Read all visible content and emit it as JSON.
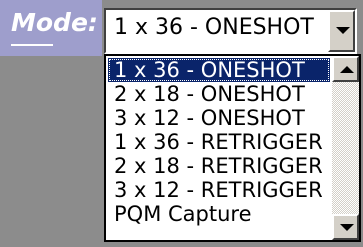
{
  "label": {
    "text": "Mode:"
  },
  "combo": {
    "value": "1 x 36 - ONESHOT"
  },
  "list": {
    "items": [
      {
        "label": "1 x 36 - ONESHOT",
        "selected": true
      },
      {
        "label": "2 x 18 - ONESHOT",
        "selected": false
      },
      {
        "label": "3 x 12 - ONESHOT",
        "selected": false
      },
      {
        "label": "1 x 36 - RETRIGGER",
        "selected": false
      },
      {
        "label": "2 x 18 - RETRIGGER",
        "selected": false
      },
      {
        "label": "3 x 12 - RETRIGGER",
        "selected": false
      },
      {
        "label": "PQM Capture",
        "selected": false
      }
    ]
  },
  "icons": {
    "combo_button": "chevron-down-icon",
    "scroll_up": "scroll-up-arrow-icon",
    "scroll_down": "scroll-down-arrow-icon"
  },
  "colors": {
    "label_bg": "#9e9ecc",
    "selection": "#0a246a",
    "background": "#8c8c8c"
  }
}
